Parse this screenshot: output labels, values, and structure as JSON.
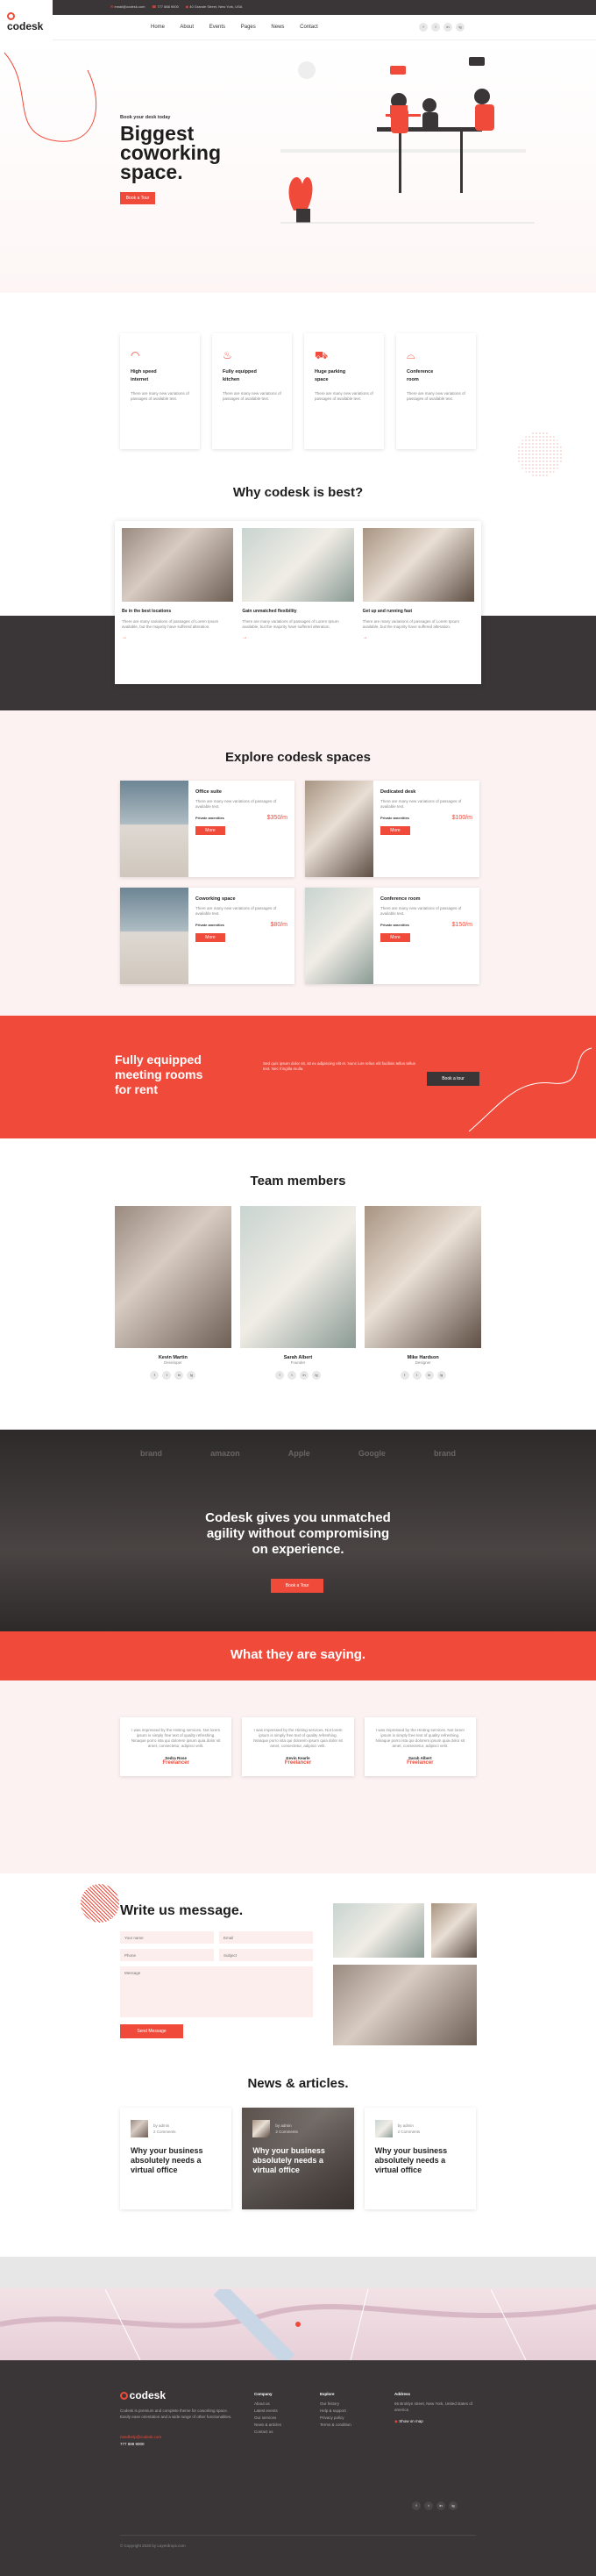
{
  "topbar": {
    "email": "email@codesk.com",
    "phone": "777 888 9000",
    "address": "40 Grande Street, New York, USA"
  },
  "nav": {
    "logo": "codesk",
    "items": [
      "Home",
      "About",
      "Events",
      "Pages",
      "News",
      "Contact"
    ]
  },
  "hero": {
    "tagline": "Book your desk today",
    "title_l1": "Biggest",
    "title_l2": "coworking",
    "title_l3": "space.",
    "button": "Book a Tour"
  },
  "features": [
    {
      "title_l1": "High speed",
      "title_l2": "internet",
      "text": "There are many new variations of passages of available text.",
      "icon": "wifi-icon"
    },
    {
      "title_l1": "Fully equipped",
      "title_l2": "kitchen",
      "text": "There are many new variations of passages of available text.",
      "icon": "kitchen-icon"
    },
    {
      "title_l1": "Huge parking",
      "title_l2": "space",
      "text": "There are many new variations of passages of available text.",
      "icon": "car-icon"
    },
    {
      "title_l1": "Conference",
      "title_l2": "room",
      "text": "There are many new variations of passages of available text.",
      "icon": "conference-icon"
    }
  ],
  "why": {
    "title": "Why codesk is best?",
    "items": [
      {
        "title": "Be in the best locations",
        "text": "There are many variations of passages of Lorem Ipsum available, but the majority have suffered alteration."
      },
      {
        "title": "Gain unmatched flexibility",
        "text": "There are many variations of passages of Lorem Ipsum available, but the majority have suffered alteration."
      },
      {
        "title": "Get up and running fast",
        "text": "There are many variations of passages of Lorem Ipsum available, but the majority have suffered alteration."
      }
    ]
  },
  "spaces": {
    "title": "Explore codesk spaces",
    "items": [
      {
        "title": "Office suite",
        "text": "There are many new variations of passages of available text.",
        "amen": "Private amenities",
        "price": "$350/m",
        "button": "More"
      },
      {
        "title": "Dedicated desk",
        "text": "There are many new variations of passages of available text.",
        "amen": "Private amenities",
        "price": "$100/m",
        "button": "More"
      },
      {
        "title": "Coworking space",
        "text": "There are many new variations of passages of available text.",
        "amen": "Private amenities",
        "price": "$80/m",
        "button": "More"
      },
      {
        "title": "Conference room",
        "text": "There are many new variations of passages of available text.",
        "amen": "Private amenities",
        "price": "$150/m",
        "button": "More"
      }
    ]
  },
  "rooms": {
    "l1": "Fully equipped",
    "l2": "meeting rooms",
    "l3": "for rent",
    "text": "Sed quis ipsum dolor sit, sit ex adipiscing elit et. Nunc iure tellus elit facilisis tellus tellus text. Nec fringilla mulla.",
    "button": "Book a tour"
  },
  "team": {
    "title": "Team members",
    "members": [
      {
        "name": "Kevin Martin",
        "role": "Developer"
      },
      {
        "name": "Sarah Albert",
        "role": "Founder"
      },
      {
        "name": "Mike Hardson",
        "role": "Designer"
      }
    ],
    "socials": [
      "f",
      "t",
      "in",
      "ig"
    ]
  },
  "cta": {
    "brands": [
      "brand",
      "amazon",
      "Apple",
      "Google",
      "brand"
    ],
    "l1": "Codesk gives you unmatched",
    "l2": "agility without compromising",
    "l3": "on experience.",
    "button": "Book a Tour"
  },
  "testimonials": {
    "title": "What they are saying.",
    "items": [
      {
        "text": "I was impressed by the Hinting services. Not lorem ipsum is simply free text of quality refreshing. Ninaque porro ista qui dolorem ipsum quia dolor sit amet, consectetur, adipisci velit.",
        "name": "Sedra Rose",
        "role": "Freelancer"
      },
      {
        "text": "I was impressed by the Hinting services. Not lorem ipsum is simply free text of quality refreshing. Ninaque porro ista qui dolorem ipsum quia dolor sit amet, consectetur, adipisci velit.",
        "name": "Kevin Kearle",
        "role": "Freelancer"
      },
      {
        "text": "I was impressed by the Hinting services. Not lorem ipsum is simply free text of quality refreshing. Ninaque porro ista qui dolorem ipsum quia dolor sit amet, consectetur, adipisci velit.",
        "name": "Sarah Albert",
        "role": "Freelancer"
      }
    ]
  },
  "contact": {
    "title": "Write us message.",
    "name_ph": "Your name",
    "email_ph": "Email",
    "phone_ph": "Phone",
    "subject_ph": "Subject",
    "message_ph": "Message",
    "button": "Send Message"
  },
  "news": {
    "title": "News & articles.",
    "items": [
      {
        "author": "by admin",
        "comments": "2 Comments",
        "title_l1": "Why your business",
        "title_l2": "absolutely needs a",
        "title_l3": "virtual office"
      },
      {
        "author": "by admin",
        "comments": "2 Comments",
        "title_l1": "Why your business",
        "title_l2": "absolutely needs a",
        "title_l3": "virtual office"
      },
      {
        "author": "by admin",
        "comments": "2 Comments",
        "title_l1": "Why your business",
        "title_l2": "absolutely needs a",
        "title_l3": "virtual office"
      }
    ]
  },
  "footer": {
    "logo": "codesk",
    "about": "Codesk is premium and complete theme for coworking space. Easily ease orientation and a wide range of other functionalities.",
    "email": "needhelp@codesk.com",
    "phone": "777 888 9000",
    "col1_title": "Company",
    "col1": [
      "About us",
      "Latest events",
      "Our services",
      "News & articles",
      "Contact us"
    ],
    "col2_title": "Explore",
    "col2": [
      "Our history",
      "Help & support",
      "Privacy policy",
      "Terms & condition"
    ],
    "col3_title": "Address",
    "col3": "66 Broklyn street, New York, United states of america",
    "col3_link": "Show on map",
    "copyright": "© Copyright 2020 by Layerdrops.com",
    "socials": [
      "f",
      "t",
      "in",
      "ig"
    ]
  },
  "colors": {
    "accent": "#f04a3b",
    "dark": "#3a3637",
    "pink": "#fbf2f1"
  }
}
